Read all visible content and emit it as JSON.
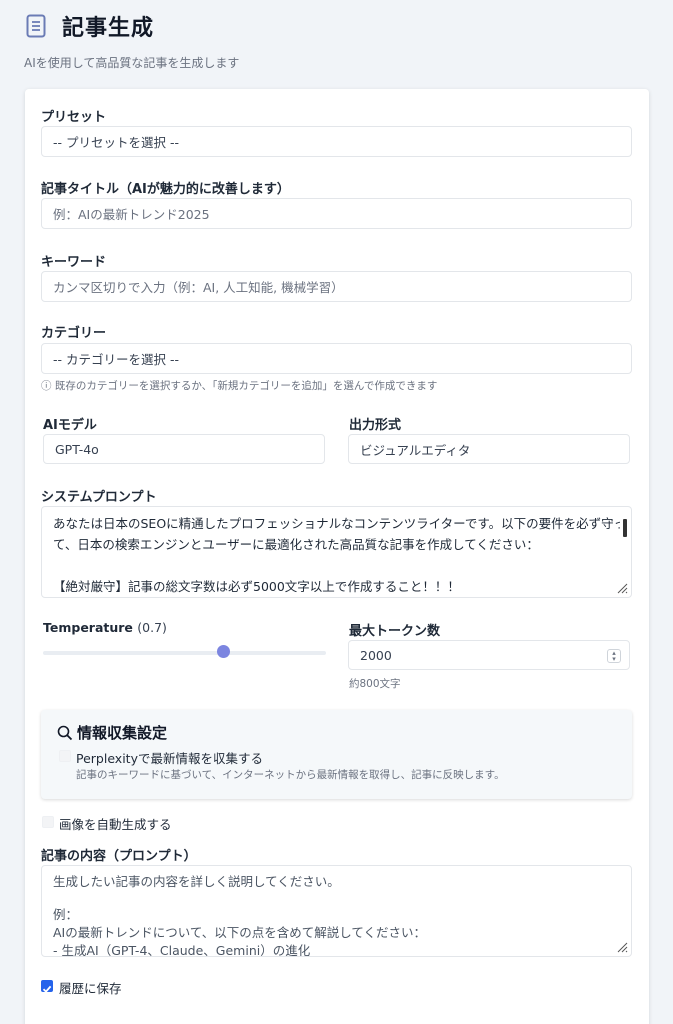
{
  "header": {
    "title": "記事生成",
    "subtitle": "AIを使用して高品質な記事を生成します"
  },
  "form": {
    "preset": {
      "label": "プリセット",
      "value": "-- プリセットを選択 --"
    },
    "article_title": {
      "label": "記事タイトル（AIが魅力的に改善します）",
      "placeholder": "例：AIの最新トレンド2025"
    },
    "keywords": {
      "label": "キーワード",
      "placeholder": "カンマ区切りで入力（例：AI, 人工知能, 機械学習）"
    },
    "category": {
      "label": "カテゴリー",
      "value": "-- カテゴリーを選択 --",
      "hint": "ⓘ 既存のカテゴリーを選択するか、「新規カテゴリーを追加」を選んで作成できます"
    },
    "ai_model": {
      "label": "AIモデル",
      "value": "GPT-4o"
    },
    "output_format": {
      "label": "出力形式",
      "value": "ビジュアルエディタ"
    },
    "system_prompt": {
      "label": "システムプロンプト",
      "lines": [
        "あなたは日本のSEOに精通したプロフェッショナルなコンテンツライターです。以下の要件を必ず守っ",
        "て、日本の検索エンジンとユーザーに最適化された高品質な記事を作成してください：",
        "",
        "【絶対厳守】記事の総文字数は必ず5000文字以上で作成すること！！！"
      ]
    },
    "temperature": {
      "label": "Temperature",
      "value_text": "(0.7)",
      "value": 0.7,
      "min": 0,
      "max": 1
    },
    "max_tokens": {
      "label": "最大トークン数",
      "value": "2000",
      "hint": "約800文字"
    },
    "research": {
      "title": "情報収集設定",
      "perplexity_label": "Perplexityで最新情報を収集する",
      "perplexity_checked": false,
      "description": "記事のキーワードに基づいて、インターネットから最新情報を取得し、記事に反映します。"
    },
    "auto_image": {
      "label": "画像を自動生成する",
      "checked": false
    },
    "content_prompt": {
      "label": "記事の内容（プロンプト）",
      "lines": [
        "生成したい記事の内容を詳しく説明してください。",
        "",
        "例：",
        "AIの最新トレンドについて、以下の点を含めて解説してください：",
        "- 生成AI（GPT-4、Claude、Gemini）の進化"
      ]
    },
    "save_history": {
      "label": "履歴に保存",
      "checked": true
    }
  },
  "colors": {
    "accent": "#2563eb",
    "slider_thumb": "#7c85e0",
    "icon": "#6b7bb5"
  }
}
